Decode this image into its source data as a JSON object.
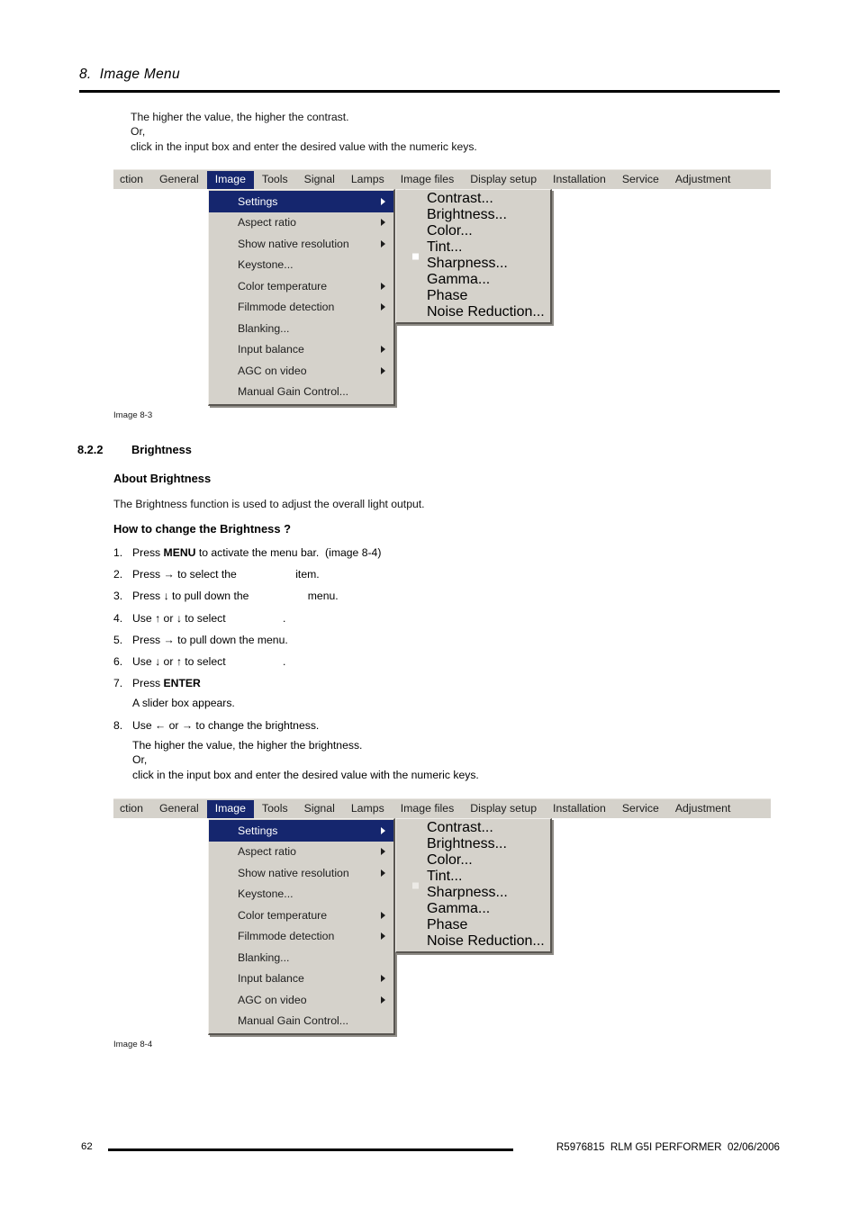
{
  "page": {
    "chapter_title": "8.  Image Menu",
    "page_number": "62",
    "footer_reference": "R5976815  RLM G5I PERFORMER  02/06/2006"
  },
  "intro_note": "The higher the value, the higher the contrast.\nOr,\nclick in the input box and enter the desired value with the numeric keys.",
  "menubar": {
    "items": [
      {
        "label": "ction",
        "active": false,
        "clipped": true
      },
      {
        "label": "General",
        "active": false
      },
      {
        "label": "Image",
        "active": true
      },
      {
        "label": "Tools",
        "active": false
      },
      {
        "label": "Signal",
        "active": false
      },
      {
        "label": "Lamps",
        "active": false
      },
      {
        "label": "Image files",
        "active": false
      },
      {
        "label": "Display setup",
        "active": false
      },
      {
        "label": "Installation",
        "active": false
      },
      {
        "label": "Service",
        "active": false
      },
      {
        "label": "Adjustment",
        "active": false
      }
    ]
  },
  "image_menu": {
    "items": [
      {
        "label": "Settings",
        "arrow": true
      },
      {
        "label": "Aspect ratio",
        "arrow": true
      },
      {
        "label": "Show native resolution",
        "arrow": true
      },
      {
        "label": "Keystone...",
        "arrow": false
      },
      {
        "label": "Color temperature",
        "arrow": true
      },
      {
        "label": "Filmmode detection",
        "arrow": true
      },
      {
        "label": "Blanking...",
        "arrow": false
      },
      {
        "label": "Input balance",
        "arrow": true
      },
      {
        "label": "AGC on video",
        "arrow": true
      },
      {
        "label": "Manual Gain Control...",
        "arrow": false
      }
    ],
    "selected": "Settings"
  },
  "settings_submenu": {
    "items": [
      {
        "label": "Contrast...",
        "bullet": true
      },
      {
        "label": "Brightness...",
        "bullet": false
      },
      {
        "label": "Color...",
        "bullet": false
      },
      {
        "label": "Tint...",
        "bullet": false
      },
      {
        "label": "Sharpness...",
        "bullet": false
      },
      {
        "label": "Gamma...",
        "bullet": false
      },
      {
        "label": "Phase",
        "bullet": false
      },
      {
        "label": "Noise Reduction...",
        "bullet": false
      }
    ]
  },
  "figure_1": {
    "caption": "Image 8-3",
    "selected_submenu_item": "Contrast...",
    "bullet_state": "filled"
  },
  "figure_2": {
    "caption": "Image 8-4",
    "selected_submenu_item": "Brightness...",
    "bullet_state": "empty"
  },
  "section": {
    "number": "8.2.2",
    "title": "Brightness",
    "about_heading": "About Brightness",
    "about_text": "The Brightness function is used to adjust the overall light output.",
    "how_heading": "How to change the Brightness ?"
  },
  "steps": [
    {
      "index": "1.",
      "pre": "Press ",
      "bold": "MENU",
      "post": " to activate the menu bar.  (image 8-4)"
    },
    {
      "index": "2.",
      "pre": "Press → to select the ",
      "gap": "g-item",
      "post": "item."
    },
    {
      "index": "3.",
      "pre": "Press ↓ to pull down the ",
      "gap": "g-menu",
      "post": "menu."
    },
    {
      "index": "4.",
      "pre": "Use ↑ or ↓ to select ",
      "gap": "g-sel1",
      "post": "."
    },
    {
      "index": "5.",
      "pre": "Press → to pull down the menu.",
      "post": ""
    },
    {
      "index": "6.",
      "pre": "Use ↓ or ↑ to select ",
      "gap": "g-sel2",
      "post": "."
    },
    {
      "index": "7.",
      "pre": "Press ",
      "bold": "ENTER",
      "post": ""
    }
  ],
  "step7_note": "A slider box appears.",
  "step8": {
    "index": "8.",
    "pre": "Use ← or → to change the brightness.",
    "post": ""
  },
  "closing_note": "The higher the value, the higher the brightness.\nOr,\nclick in the input box and enter the desired value with the numeric keys.",
  "colors": {
    "menu_highlight": "#15266e",
    "menu_face": "#d5d2cb",
    "menu_shadow": "#595651",
    "text": "#1d1d1d"
  }
}
